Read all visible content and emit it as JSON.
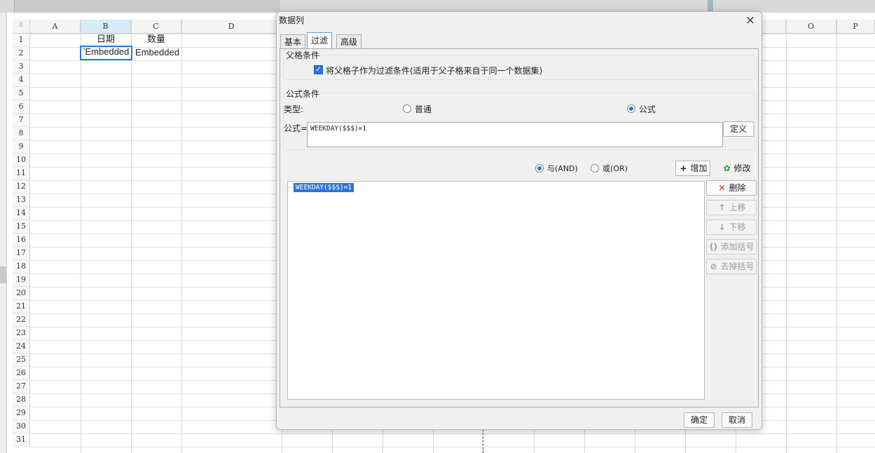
{
  "sheet": {
    "columns": [
      {
        "label": "A"
      },
      {
        "label": "B"
      },
      {
        "label": "C"
      },
      {
        "label": "D"
      },
      {
        "label": "O"
      },
      {
        "label": "P"
      }
    ],
    "rows": [
      "1",
      "2",
      "3",
      "4",
      "5",
      "6",
      "7",
      "8",
      "9",
      "10",
      "11",
      "12",
      "13",
      "14",
      "15",
      "16",
      "17",
      "18",
      "19",
      "20",
      "21",
      "22",
      "23",
      "24",
      "25",
      "26",
      "27",
      "28",
      "29",
      "30",
      "31"
    ],
    "cells": {
      "b1": "日期",
      "c1": "数量",
      "b2": "ʼEmbedded",
      "c2": "Embedded"
    }
  },
  "dialog": {
    "title": "数据列",
    "close_icon": "×",
    "tabs": [
      {
        "label": "基本",
        "active": false
      },
      {
        "label": "过滤",
        "active": true
      },
      {
        "label": "高级",
        "active": false
      }
    ],
    "parent_condition": {
      "group_title": "父格条件",
      "checkbox_label": "将父格子作为过滤条件(适用于父子格来自于同一个数据集)",
      "checked": true
    },
    "formula_condition": {
      "group_title": "公式条件",
      "type_label": "类型:",
      "type_options": [
        {
          "label": "普通",
          "selected": false
        },
        {
          "label": "公式",
          "selected": true
        }
      ],
      "formula_label": "公式=",
      "formula_value": "WEEKDAY($$$)=1",
      "define_button": "定义"
    },
    "logic": {
      "and_label": "与(AND)",
      "or_label": "或(OR)",
      "selected": "AND",
      "add_button": "增加",
      "modify_button": "修改"
    },
    "condition_list": [
      "WEEKDAY($$$)=1"
    ],
    "side_buttons": [
      {
        "label": "删除",
        "icon": "delete-icon",
        "enabled": true
      },
      {
        "label": "上移",
        "icon": "arrow-up-icon",
        "enabled": false
      },
      {
        "label": "下移",
        "icon": "arrow-down-icon",
        "enabled": false
      },
      {
        "label": "添加括号",
        "icon": "add-bracket-icon",
        "enabled": false
      },
      {
        "label": "去掉括号",
        "icon": "remove-bracket-icon",
        "enabled": false
      }
    ],
    "ok_button": "确定",
    "cancel_button": "取消"
  },
  "colors": {
    "accent": "#2c74d6",
    "selected_col_header": "#d6ecf7",
    "delete_icon": "#d9281c",
    "modify_icon": "#2a9d3a"
  }
}
